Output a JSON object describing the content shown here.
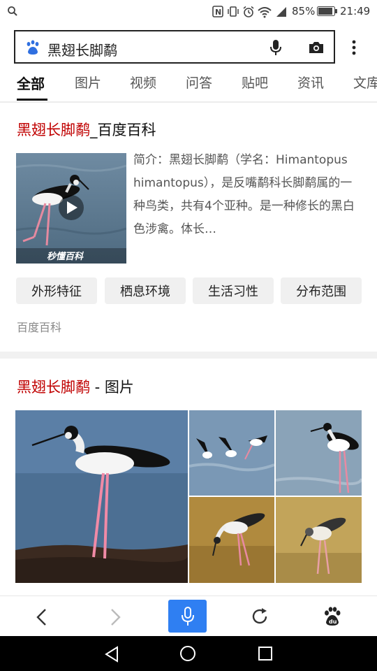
{
  "status_bar": {
    "battery": "85%",
    "time": "21:49",
    "icons": [
      "search-icon",
      "nfc-icon",
      "vibrate-icon",
      "alarm-icon",
      "wifi-icon",
      "signal-icon",
      "battery-icon"
    ]
  },
  "search": {
    "query": "黑翅长脚鹬",
    "icons": [
      "baidu-paw-icon",
      "microphone-icon",
      "camera-icon",
      "more-vertical-icon"
    ]
  },
  "tabs": [
    {
      "label": "全部",
      "active": true
    },
    {
      "label": "图片"
    },
    {
      "label": "视频"
    },
    {
      "label": "问答"
    },
    {
      "label": "贴吧"
    },
    {
      "label": "资讯"
    },
    {
      "label": "文库"
    }
  ],
  "baike": {
    "title_highlight": "黑翅长脚鹬",
    "title_rest": "_百度百科",
    "summary": "简介：黑翅长脚鹬（学名：Himantopus himantopus），是反嘴鹬科长脚鹬属的一种鸟类，共有4个亚种。是一种修长的黑白色涉禽。体长…",
    "watermark": "秒懂百科",
    "chips": [
      "外形特征",
      "栖息环境",
      "生活习性",
      "分布范围"
    ],
    "source": "百度百科"
  },
  "images_section": {
    "title_highlight": "黑翅长脚鹬",
    "title_rest": " - 图片"
  },
  "bottom_bar": {
    "icons": [
      "back-arrow-icon",
      "forward-arrow-icon",
      "microphone-icon",
      "refresh-icon",
      "baidu-paw-icon"
    ],
    "accent": "#2f7ff2"
  },
  "nav_bar": {
    "icons": [
      "nav-back-triangle-icon",
      "nav-home-circle-icon",
      "nav-recents-square-icon"
    ]
  }
}
